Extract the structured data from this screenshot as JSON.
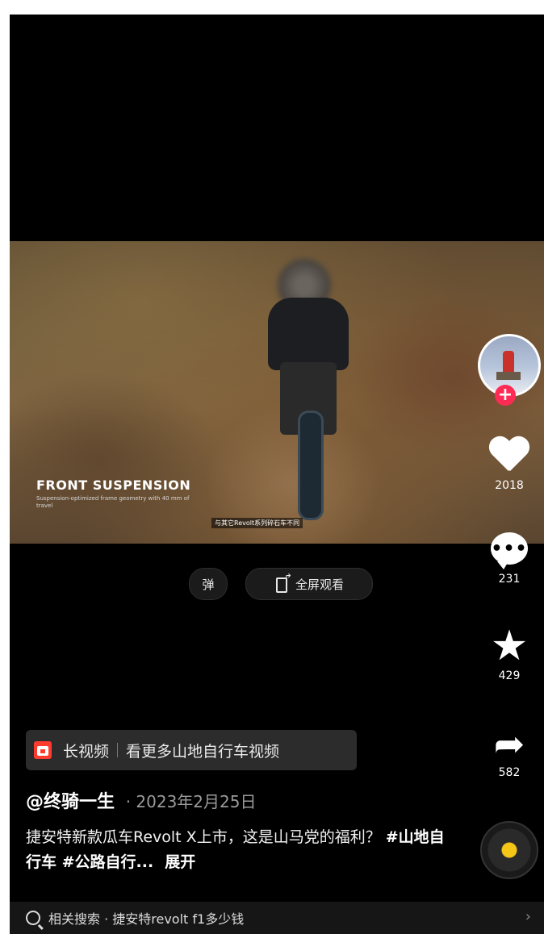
{
  "video": {
    "overlay_title": "FRONT SUSPENSION",
    "overlay_subtitle": "Suspension-optimized frame geometry with 40 mm of travel",
    "caption_strip": "与其它Revolt系列碎石车不同"
  },
  "controls": {
    "danmu_label": "弹",
    "fullscreen_label": "全屏观看"
  },
  "actions": {
    "likes": "2018",
    "comments": "231",
    "favorites": "429",
    "shares": "582",
    "follow_symbol": "+",
    "comment_glyph": "•••",
    "favorite_glyph": "★",
    "share_glyph": "➦"
  },
  "long_video": {
    "label": "长视频",
    "text": "看更多山地自行车视频"
  },
  "author": {
    "handle": "@终骑一生",
    "date": "· 2023年2月25日"
  },
  "caption": {
    "text": "捷安特新款瓜车Revolt X上市，这是山马党的福利？",
    "tags": "#山地自行车 #公路自行...",
    "more": "展开"
  },
  "search": {
    "text": "相关搜索 · 捷安特revolt f1多少钱",
    "chevron": "›"
  },
  "icons": [
    "heart-icon",
    "comment-icon",
    "star-icon",
    "share-icon",
    "search-icon",
    "fullscreen-icon",
    "long-video-icon",
    "music-disc-icon"
  ],
  "colors": {
    "accent": "#fe2c55",
    "long_video_icon": "#ff3b30",
    "disc_center": "#f5c518"
  }
}
